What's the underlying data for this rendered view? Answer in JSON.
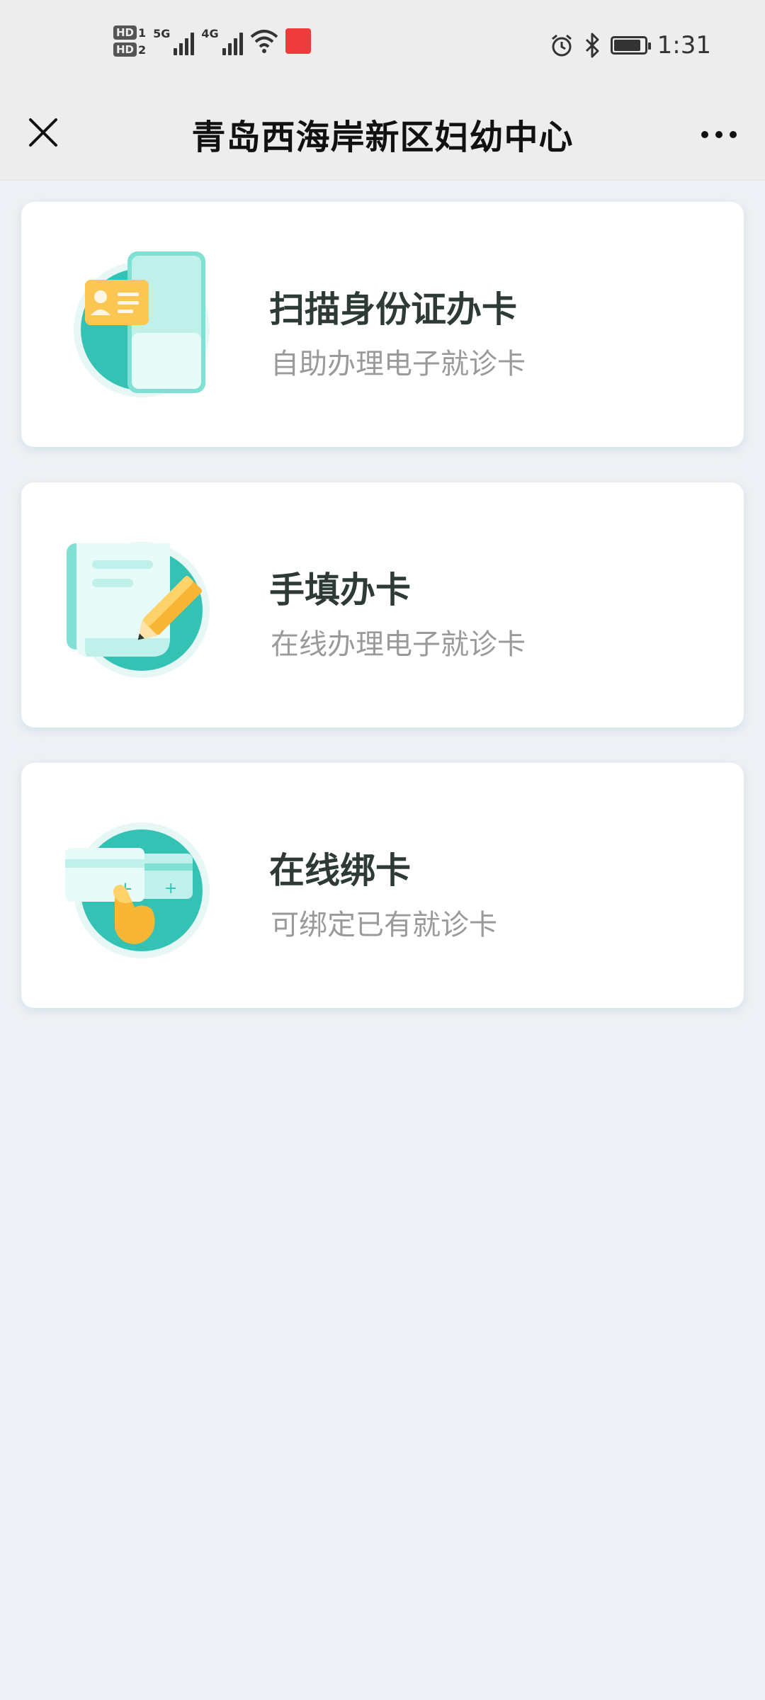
{
  "status_bar": {
    "hd1": "HD",
    "hd1_sub": "1",
    "hd2": "HD",
    "hd2_sub": "2",
    "sig1_label": "5G",
    "sig2_label": "4G",
    "time": "1:31",
    "icons": [
      "signal-5g-icon",
      "signal-4g-icon",
      "wifi-icon",
      "app-badge-icon",
      "alarm-icon",
      "bluetooth-icon",
      "battery-icon"
    ]
  },
  "nav": {
    "title": "青岛西海岸新区妇幼中心",
    "close_icon": "close-icon",
    "more_icon": "more-icon"
  },
  "cards": [
    {
      "title": "扫描身份证办卡",
      "subtitle": "自助办理电子就诊卡",
      "icon": "id-card-scan-icon"
    },
    {
      "title": "手填办卡",
      "subtitle": "在线办理电子就诊卡",
      "icon": "form-pen-icon"
    },
    {
      "title": "在线绑卡",
      "subtitle": "可绑定已有就诊卡",
      "icon": "card-bind-hand-icon"
    }
  ],
  "colors": {
    "teal": "#33c2b3",
    "teal_light": "#bff0ea",
    "orange": "#f7b635",
    "page_bg": "#eff0f5",
    "title_text": "#2d3a36",
    "subtitle_text": "#9a9a9a"
  }
}
